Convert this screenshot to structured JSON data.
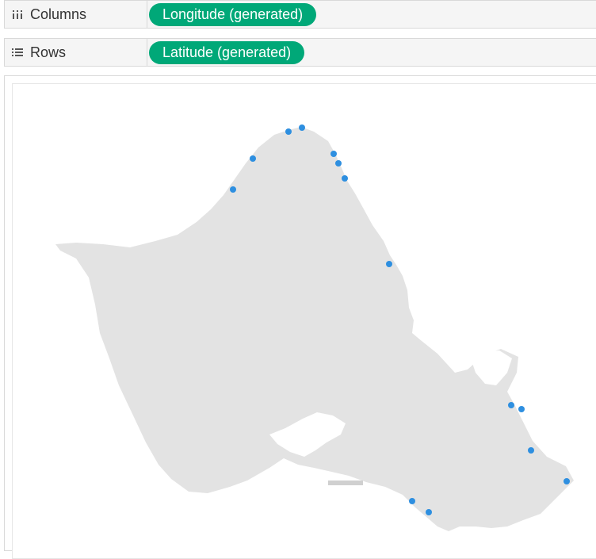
{
  "shelves": {
    "columns": {
      "label": "Columns",
      "icon": "columns-icon",
      "pill": "Longitude (generated)"
    },
    "rows": {
      "label": "Rows",
      "icon": "rows-icon",
      "pill": "Latitude (generated)"
    }
  },
  "colors": {
    "pill": "#00a878",
    "mark": "#2e8fe0",
    "land": "#e3e3e3"
  }
}
